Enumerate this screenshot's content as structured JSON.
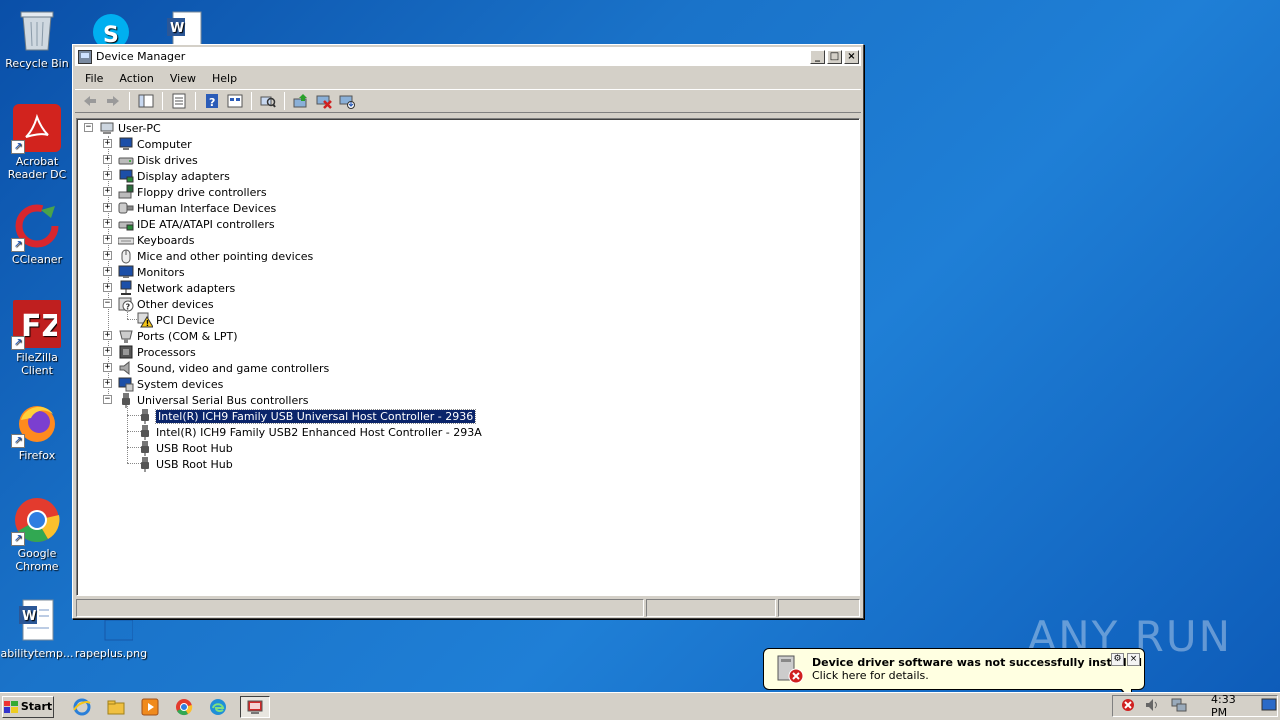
{
  "desktop": {
    "icons": [
      {
        "label": "Recycle Bin",
        "icon": "recycle-bin-icon"
      },
      {
        "label": "Acrobat Reader DC",
        "icon": "acrobat-icon"
      },
      {
        "label": "CCleaner",
        "icon": "ccleaner-icon"
      },
      {
        "label": "FileZilla Client",
        "icon": "filezilla-icon"
      },
      {
        "label": "Firefox",
        "icon": "firefox-icon"
      },
      {
        "label": "Google Chrome",
        "icon": "chrome-icon"
      },
      {
        "label": "abilitytemp...",
        "icon": "word-document-icon"
      },
      {
        "label": "rapeplus.png",
        "icon": "image-file-icon"
      }
    ],
    "watermark": "ANY RUN"
  },
  "window": {
    "title": "Device Manager",
    "controls": {
      "minimize": "_",
      "maximize": "□",
      "close": "×"
    },
    "menu": [
      "File",
      "Action",
      "View",
      "Help"
    ],
    "toolbar": [
      "back-icon",
      "forward-icon",
      "console-tree-icon",
      "properties-icon",
      "help-icon",
      "view-icon",
      "scan-hardware-icon",
      "update-driver-icon",
      "uninstall-icon",
      "disable-icon"
    ],
    "tree": {
      "root": "User-PC",
      "categories": [
        {
          "label": "Computer",
          "expanded": false
        },
        {
          "label": "Disk drives",
          "expanded": false
        },
        {
          "label": "Display adapters",
          "expanded": false
        },
        {
          "label": "Floppy drive controllers",
          "expanded": false
        },
        {
          "label": "Human Interface Devices",
          "expanded": false
        },
        {
          "label": "IDE ATA/ATAPI controllers",
          "expanded": false
        },
        {
          "label": "Keyboards",
          "expanded": false
        },
        {
          "label": "Mice and other pointing devices",
          "expanded": false
        },
        {
          "label": "Monitors",
          "expanded": false
        },
        {
          "label": "Network adapters",
          "expanded": false
        },
        {
          "label": "Other devices",
          "expanded": true,
          "children": [
            {
              "label": "PCI Device",
              "warning": true
            }
          ]
        },
        {
          "label": "Ports (COM & LPT)",
          "expanded": false
        },
        {
          "label": "Processors",
          "expanded": false
        },
        {
          "label": "Sound, video and game controllers",
          "expanded": false
        },
        {
          "label": "System devices",
          "expanded": false
        },
        {
          "label": "Universal Serial Bus controllers",
          "expanded": true,
          "children": [
            {
              "label": "Intel(R) ICH9 Family USB Universal Host Controller - 2936",
              "selected": true
            },
            {
              "label": "Intel(R) ICH9 Family USB2 Enhanced Host Controller - 293A"
            },
            {
              "label": "USB Root Hub"
            },
            {
              "label": "USB Root Hub"
            }
          ]
        }
      ]
    }
  },
  "taskbar": {
    "start_label": "Start",
    "quick_launch": [
      "ie-icon",
      "explorer-icon",
      "media-player-icon",
      "chrome-icon",
      "edge-icon",
      "device-manager-task-icon"
    ],
    "clock": "4:33 PM"
  },
  "notification": {
    "title": "Device driver software was not successfully installed",
    "text": "Click here for details.",
    "close": "×",
    "options": "⚙"
  },
  "colors": {
    "selection": "#0a246a",
    "balloon": "#ffffe1",
    "desktop": "#1a73c9"
  }
}
